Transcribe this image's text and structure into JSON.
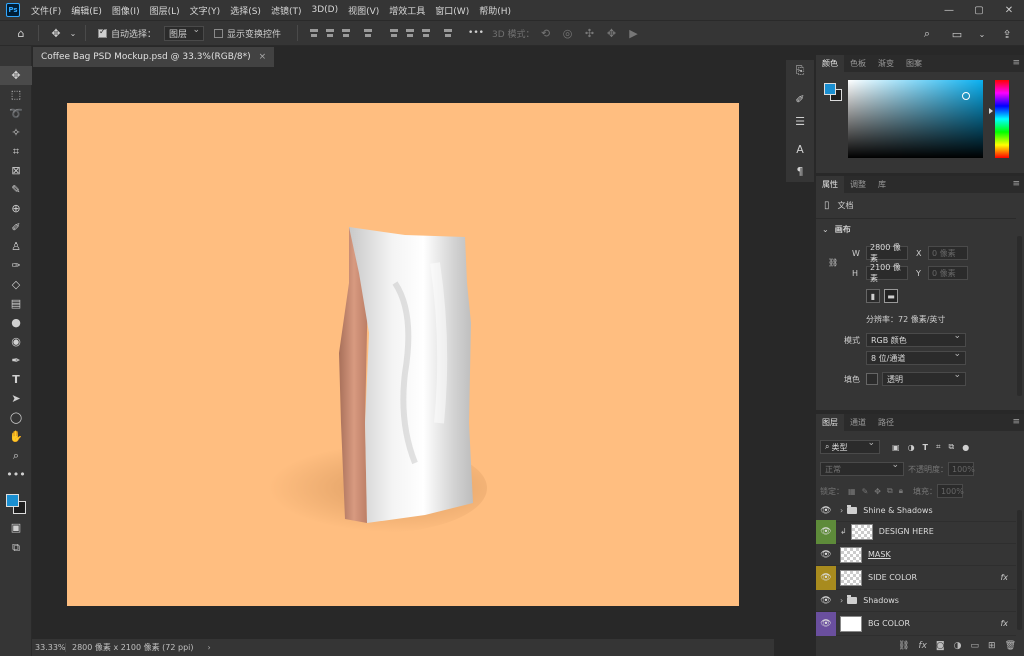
{
  "menubar": {
    "items": [
      "文件(F)",
      "编辑(E)",
      "图像(I)",
      "图层(L)",
      "文字(Y)",
      "选择(S)",
      "滤镜(T)",
      "3D(D)",
      "视图(V)",
      "增效工具",
      "窗口(W)",
      "帮助(H)"
    ],
    "window_controls": [
      "—",
      "▢",
      "✕"
    ]
  },
  "options": {
    "auto_select_label": "自动选择：",
    "auto_select_target": "图层",
    "show_transform_label": "显示变换控件",
    "more_label": "•••",
    "mode_3d_label": "3D 模式："
  },
  "document": {
    "tab_title": "Coffee Bag PSD Mockup.psd @ 33.3%(RGB/8*)",
    "close": "×"
  },
  "status": {
    "zoom": "33.33%",
    "info": "2800 像素 x 2100 像素 (72 ppi)",
    "arrow": "›"
  },
  "colors": {
    "foreground": "#1a8fd1",
    "background": "#1e1e1e",
    "canvas": "#ffbe80"
  },
  "color_panel": {
    "tabs": [
      "颜色",
      "色板",
      "渐变",
      "图案"
    ]
  },
  "properties_panel": {
    "tabs": [
      "属性",
      "调整",
      "库"
    ],
    "doc_label": "文档",
    "canvas_section": "画布",
    "w_label": "W",
    "w_value": "2800 像素",
    "x_label": "X",
    "x_placeholder": "0 像素",
    "h_label": "H",
    "h_value": "2100 像素",
    "y_label": "Y",
    "y_placeholder": "0 像素",
    "resolution": "分辨率：72 像素/英寸",
    "mode_label": "模式",
    "mode_value": "RGB 颜色",
    "depth_value": "8 位/通道",
    "fill_label": "填色",
    "fill_value": "透明"
  },
  "layers_panel": {
    "tabs": [
      "图层",
      "通道",
      "路径"
    ],
    "filter_kind": "类型",
    "blend_mode": "正常",
    "opacity_label": "不透明度：",
    "opacity_value": "100%",
    "lock_label": "锁定：",
    "fill_label": "填充：",
    "fill_value": "100%",
    "layers": [
      {
        "name": "Shine & Shadows",
        "type": "group",
        "color": "none"
      },
      {
        "name": "DESIGN HERE",
        "type": "smart",
        "color": "green"
      },
      {
        "name": "MASK",
        "type": "pixel",
        "color": "none"
      },
      {
        "name": "SIDE COLOR",
        "type": "pixel",
        "color": "yellow",
        "fx": "fx"
      },
      {
        "name": "Shadows",
        "type": "group",
        "color": "none"
      },
      {
        "name": "BG COLOR",
        "type": "fill",
        "color": "purple",
        "fx": "fx"
      }
    ],
    "footer_icons": [
      "link-icon",
      "fx-icon",
      "mask-icon",
      "adjustment-icon",
      "folder-icon",
      "new-layer-icon",
      "trash-icon"
    ]
  }
}
